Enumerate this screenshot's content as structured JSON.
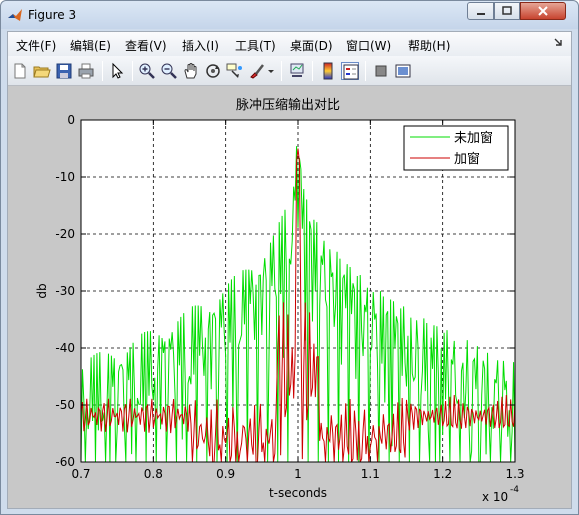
{
  "window": {
    "title": "Figure 3"
  },
  "menu": [
    "文件(F)",
    "编辑(E)",
    "查看(V)",
    "插入(I)",
    "工具(T)",
    "桌面(D)",
    "窗口(W)",
    "帮助(H)"
  ],
  "toolbar": {
    "icons": [
      "new-figure-icon",
      "open-file-icon",
      "save-icon",
      "print-icon",
      "pointer-icon",
      "zoom-in-icon",
      "zoom-out-icon",
      "pan-icon",
      "rotate-3d-icon",
      "data-cursor-icon",
      "brush-icon",
      "link-plot-icon",
      "colorbar-icon",
      "legend-icon",
      "hide-plot-tools-icon",
      "show-plot-tools-icon"
    ]
  },
  "colors": {
    "unwindowed": "#00dd00",
    "windowed": "#cc0000",
    "axes_bg": "#ffffff",
    "figure_bg": "#c8c8c8"
  },
  "chart_data": {
    "type": "line",
    "title": "脉冲压缩输出对比",
    "xlabel": "t-seconds",
    "ylabel": "db",
    "x_exponent": "x 10",
    "x_exponent_power": "-4",
    "xlim": [
      0.7,
      1.3
    ],
    "ylim": [
      -60,
      0
    ],
    "xticks": [
      "0.7",
      "0.8",
      "0.9",
      "1",
      "1.1",
      "1.2",
      "1.3"
    ],
    "yticks": [
      "0",
      "-10",
      "-20",
      "-30",
      "-40",
      "-50",
      "-60"
    ],
    "grid": true,
    "legend_position": "top-right",
    "series": [
      {
        "name": "未加窗",
        "color": "#00dd00",
        "peak": 0,
        "sidelobe_near": -13,
        "sidelobe_far": -42,
        "floor": -60
      },
      {
        "name": "加窗",
        "color": "#cc0000",
        "peak": -5,
        "sidelobe_level": -50,
        "floor": -60
      }
    ]
  }
}
